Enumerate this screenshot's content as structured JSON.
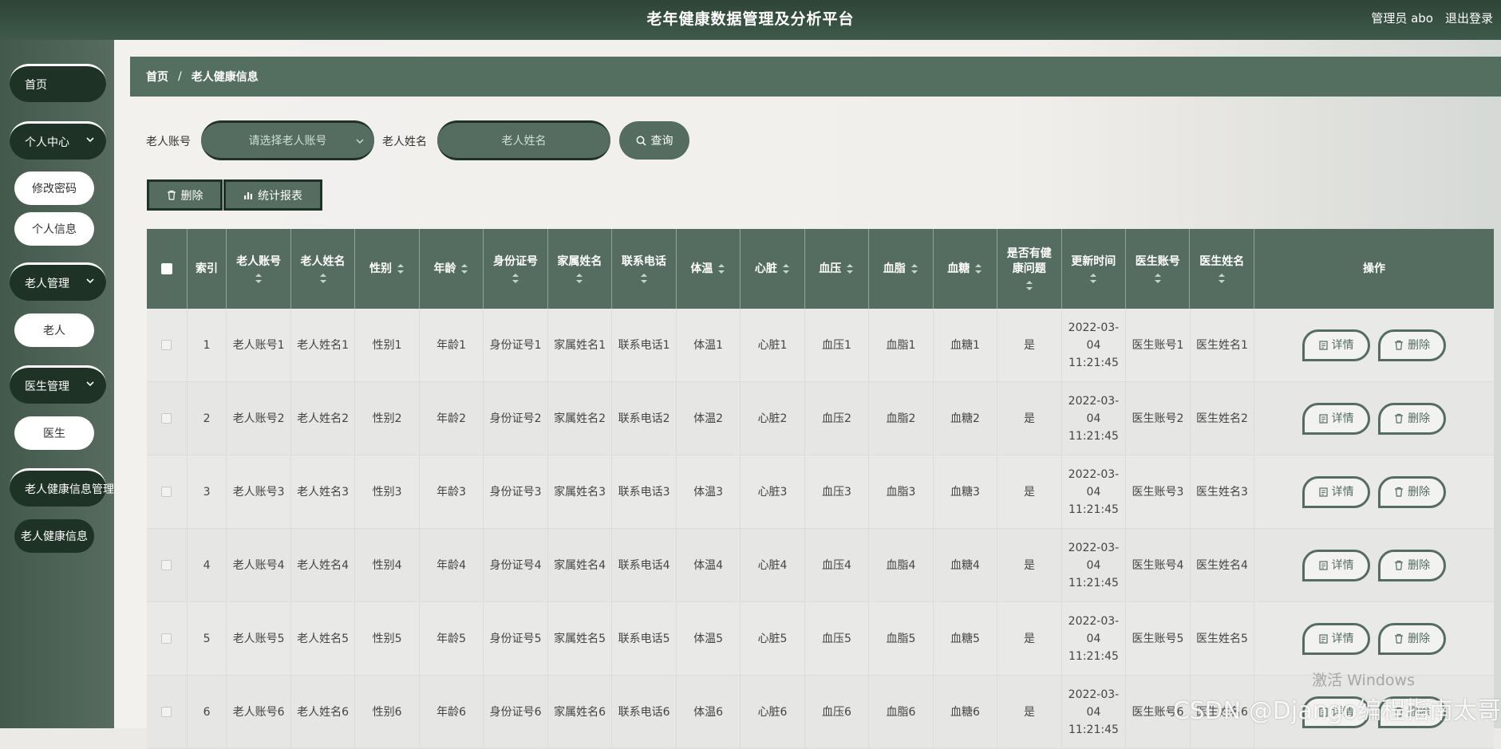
{
  "header": {
    "title": "老年健康数据管理及分析平台",
    "admin_label": "管理员 abo",
    "logout_label": "退出登录"
  },
  "sidebar": {
    "home": "首页",
    "personal_center": "个人中心",
    "change_password": "修改密码",
    "personal_info": "个人信息",
    "elder_mgmt": "老人管理",
    "elder": "老人",
    "doctor_mgmt": "医生管理",
    "doctor": "医生",
    "health_mgmt": "老人健康信息管理",
    "health_info": "老人健康信息"
  },
  "breadcrumb": {
    "home": "首页",
    "sep": "/",
    "current": "老人健康信息"
  },
  "search": {
    "account_label": "老人账号",
    "account_placeholder": "请选择老人账号",
    "name_label": "老人姓名",
    "name_placeholder": "老人姓名",
    "search_button": "查询"
  },
  "actions": {
    "delete": "删除",
    "report": "统计报表"
  },
  "table": {
    "columns": [
      "索引",
      "老人账号",
      "老人姓名",
      "性别",
      "年龄",
      "身份证号",
      "家属姓名",
      "联系电话",
      "体温",
      "心脏",
      "血压",
      "血脂",
      "血糖",
      "是否有健康问题",
      "更新时间",
      "医生账号",
      "医生姓名",
      "操作"
    ],
    "detail_label": "详情",
    "delete_label": "删除",
    "rows": [
      {
        "index": "1",
        "account": "老人账号1",
        "name": "老人姓名1",
        "gender": "性别1",
        "age": "年龄1",
        "idcard": "身份证号1",
        "family": "家属姓名1",
        "phone": "联系电话1",
        "temp": "体温1",
        "heart": "心脏1",
        "bp": "血压1",
        "lipid": "血脂1",
        "sugar": "血糖1",
        "problem": "是",
        "time": "2022-03-04 11:21:45",
        "doc_account": "医生账号1",
        "doc_name": "医生姓名1"
      },
      {
        "index": "2",
        "account": "老人账号2",
        "name": "老人姓名2",
        "gender": "性别2",
        "age": "年龄2",
        "idcard": "身份证号2",
        "family": "家属姓名2",
        "phone": "联系电话2",
        "temp": "体温2",
        "heart": "心脏2",
        "bp": "血压2",
        "lipid": "血脂2",
        "sugar": "血糖2",
        "problem": "是",
        "time": "2022-03-04 11:21:45",
        "doc_account": "医生账号2",
        "doc_name": "医生姓名2"
      },
      {
        "index": "3",
        "account": "老人账号3",
        "name": "老人姓名3",
        "gender": "性别3",
        "age": "年龄3",
        "idcard": "身份证号3",
        "family": "家属姓名3",
        "phone": "联系电话3",
        "temp": "体温3",
        "heart": "心脏3",
        "bp": "血压3",
        "lipid": "血脂3",
        "sugar": "血糖3",
        "problem": "是",
        "time": "2022-03-04 11:21:45",
        "doc_account": "医生账号3",
        "doc_name": "医生姓名3"
      },
      {
        "index": "4",
        "account": "老人账号4",
        "name": "老人姓名4",
        "gender": "性别4",
        "age": "年龄4",
        "idcard": "身份证号4",
        "family": "家属姓名4",
        "phone": "联系电话4",
        "temp": "体温4",
        "heart": "心脏4",
        "bp": "血压4",
        "lipid": "血脂4",
        "sugar": "血糖4",
        "problem": "是",
        "time": "2022-03-04 11:21:45",
        "doc_account": "医生账号4",
        "doc_name": "医生姓名4"
      },
      {
        "index": "5",
        "account": "老人账号5",
        "name": "老人姓名5",
        "gender": "性别5",
        "age": "年龄5",
        "idcard": "身份证号5",
        "family": "家属姓名5",
        "phone": "联系电话5",
        "temp": "体温5",
        "heart": "心脏5",
        "bp": "血压5",
        "lipid": "血脂5",
        "sugar": "血糖5",
        "problem": "是",
        "time": "2022-03-04 11:21:45",
        "doc_account": "医生账号5",
        "doc_name": "医生姓名5"
      },
      {
        "index": "6",
        "account": "老人账号6",
        "name": "老人姓名6",
        "gender": "性别6",
        "age": "年龄6",
        "idcard": "身份证号6",
        "family": "家属姓名6",
        "phone": "联系电话6",
        "temp": "体温6",
        "heart": "心脏6",
        "bp": "血压6",
        "lipid": "血脂6",
        "sugar": "血糖6",
        "problem": "是",
        "time": "2022-03-04 11:21:45",
        "doc_account": "医生账号6",
        "doc_name": "医生姓名6"
      }
    ]
  },
  "watermarks": {
    "windows": "激活 Windows",
    "csdn": "CSDN @Django编程指南太哥"
  },
  "colors": {
    "primary": "#556d60",
    "dark": "#1f3226",
    "header": "#3a5143"
  }
}
